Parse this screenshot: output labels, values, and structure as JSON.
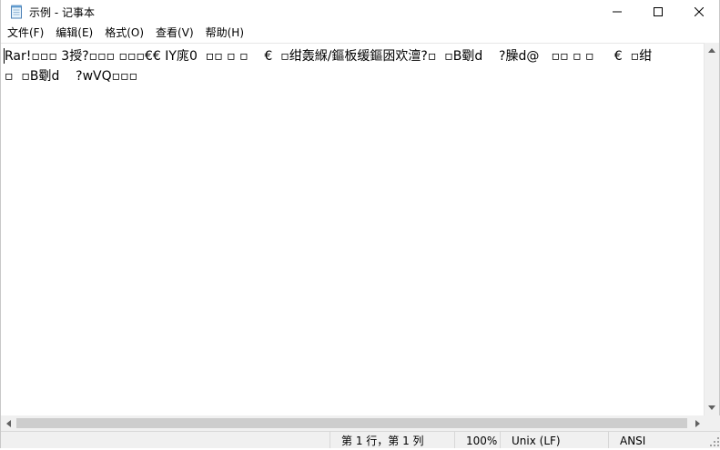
{
  "window": {
    "title": "示例 - 记事本",
    "controls": {
      "minimize": "—",
      "maximize": "☐",
      "close": "✕"
    }
  },
  "menu": [
    {
      "label": "文件(F)"
    },
    {
      "label": "编辑(E)"
    },
    {
      "label": "格式(O)"
    },
    {
      "label": "查看(V)"
    },
    {
      "label": "帮助(H)"
    }
  ],
  "editor": {
    "lines": [
      "Rar!▫▫▫ 3授?▫▫▫ ▫▫▫€€ IY庣0  ▫▫ ▫ ▫    €  ▫绀轰緥/鏂板缓鏂囦欢澶?▫  ▫B劅d    ?臊d@   ▫▫ ▫ ▫     €  ▫绀",
      "▫  ▫B劅d    ?wVQ▫▫▫"
    ]
  },
  "status": {
    "position": "第 1 行，第 1 列",
    "zoom": "100%",
    "line_ending": "Unix (LF)",
    "encoding": "ANSI"
  },
  "icons": {
    "app": "notepad-icon",
    "scroll_up": "scroll-up-arrow-icon",
    "scroll_down": "scroll-down-arrow-icon",
    "scroll_left": "scroll-left-arrow-icon",
    "scroll_right": "scroll-right-arrow-icon"
  }
}
